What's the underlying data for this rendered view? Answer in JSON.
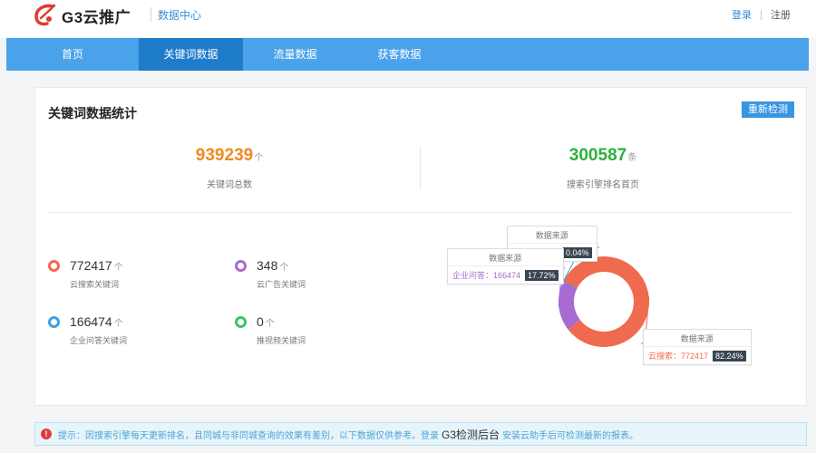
{
  "header": {
    "logo_text": "G3云推广",
    "subtitle": "数据中心",
    "login": "登录",
    "register": "注册"
  },
  "nav": {
    "items": [
      {
        "label": "首页",
        "active": false
      },
      {
        "label": "关键词数据",
        "active": true
      },
      {
        "label": "流量数据",
        "active": false
      },
      {
        "label": "获客数据",
        "active": false
      }
    ]
  },
  "card": {
    "title": "关键词数据统计",
    "recheck_label": "重新检测",
    "total": {
      "value": "939239",
      "unit": "个",
      "label": "关键词总数"
    },
    "ranked": {
      "value": "300587",
      "unit": "条",
      "label": "搜索引擎排名首页"
    },
    "legend": [
      {
        "value": "772417",
        "unit": "个",
        "label": "云搜索关键词",
        "color": "#f06a50"
      },
      {
        "value": "348",
        "unit": "个",
        "label": "云广告关键词",
        "color": "#a56bd0"
      },
      {
        "value": "166474",
        "unit": "个",
        "label": "企业问答关键词",
        "color": "#39a3df"
      },
      {
        "value": "0",
        "unit": "个",
        "label": "推视频关键词",
        "color": "#3cc36a"
      }
    ]
  },
  "chart_data": {
    "type": "pie",
    "style": "donut",
    "tooltip_title": "数据来源",
    "slices": [
      {
        "name": "云搜索",
        "value": 772417,
        "percent": "82.24%",
        "color": "#f06a50"
      },
      {
        "name": "企业问答",
        "value": 166474,
        "percent": "17.72%",
        "color": "#a56bd0"
      },
      {
        "name": "云广告",
        "value": 348,
        "percent": "0.04%",
        "color": "#39a3df"
      }
    ]
  },
  "notice": {
    "icon": "alert-icon",
    "text_before": "提示：因搜索引擎每天更新排名，且同城与非同城查询的效果有差别，以下数据仅供参考。登录",
    "brand": "G3检测后台",
    "text_after": "安装云助手后可检测最新的报表。"
  }
}
